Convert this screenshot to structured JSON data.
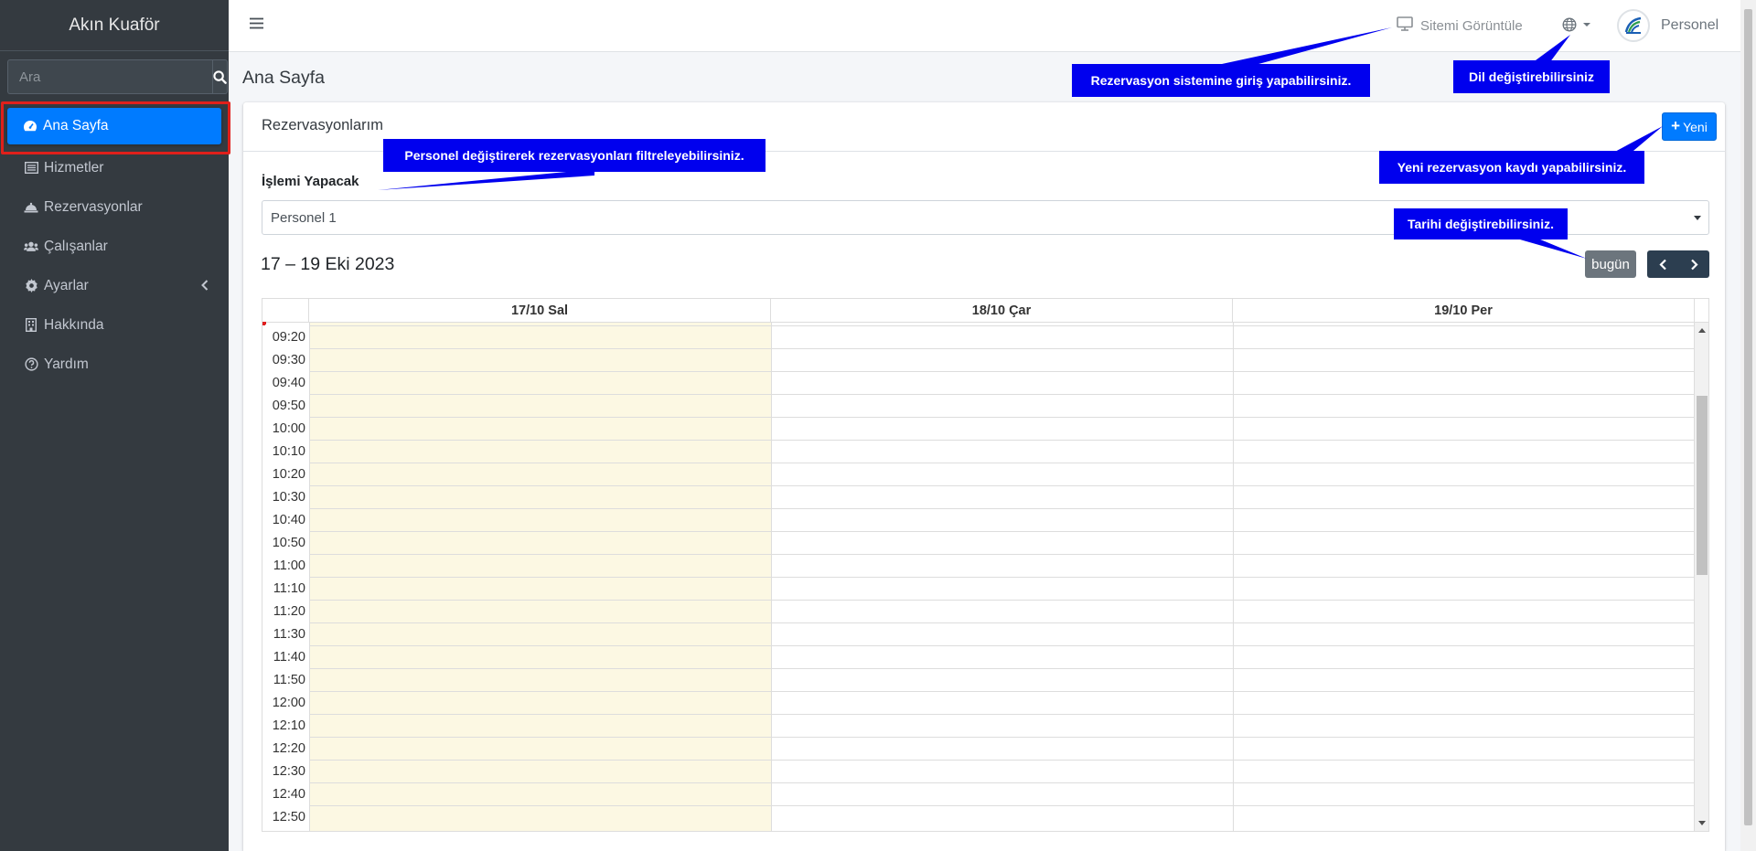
{
  "sidebar": {
    "brand": "Akın Kuaför",
    "search_placeholder": "Ara",
    "items": [
      {
        "label": "Ana Sayfa",
        "icon": "dashboard-icon",
        "active": true
      },
      {
        "label": "Hizmetler",
        "icon": "list-icon"
      },
      {
        "label": "Rezervasyonlar",
        "icon": "bell-icon"
      },
      {
        "label": "Çalışanlar",
        "icon": "users-icon"
      },
      {
        "label": "Ayarlar",
        "icon": "gear-icon"
      },
      {
        "label": "Hakkında",
        "icon": "building-icon"
      },
      {
        "label": "Yardım",
        "icon": "question-circle-icon"
      }
    ]
  },
  "topbar": {
    "view_site": "Sitemi Görüntüle",
    "user": "Personel"
  },
  "main": {
    "page_title": "Ana Sayfa",
    "card_title": "Rezervasyonlarım",
    "new_button": "Yeni",
    "field_label": "İşlemi Yapacak",
    "selected_staff": "Personel 1",
    "calendar_title": "17 – 19 Eki 2023",
    "today_button": "bugün",
    "days": [
      "17/10 Sal",
      "18/10 Çar",
      "19/10 Per"
    ],
    "times": [
      "09:20",
      "09:30",
      "09:40",
      "09:50",
      "10:00",
      "10:10",
      "10:20",
      "10:30",
      "10:40",
      "10:50",
      "11:00",
      "11:10",
      "11:20",
      "11:30",
      "11:40",
      "11:50",
      "12:00",
      "12:10",
      "12:20",
      "12:30",
      "12:40",
      "12:50"
    ]
  },
  "tooltips": {
    "site": "Rezervasyon sistemine giriş yapabilirsiniz.",
    "lang": "Dil değiştirebilirsiniz",
    "staff": "Personel değiştirerek rezervasyonları filtreleyebilirsiniz.",
    "new": "Yeni rezervasyon kaydı yapabilirsiniz.",
    "date": "Tarihi değiştirebilirsiniz."
  },
  "colors": {
    "sidebar_bg": "#343a40",
    "active": "#007bff",
    "tooltip": "#0000ee",
    "today_column": "#fcf8e3",
    "highlight": "#e0201b"
  }
}
